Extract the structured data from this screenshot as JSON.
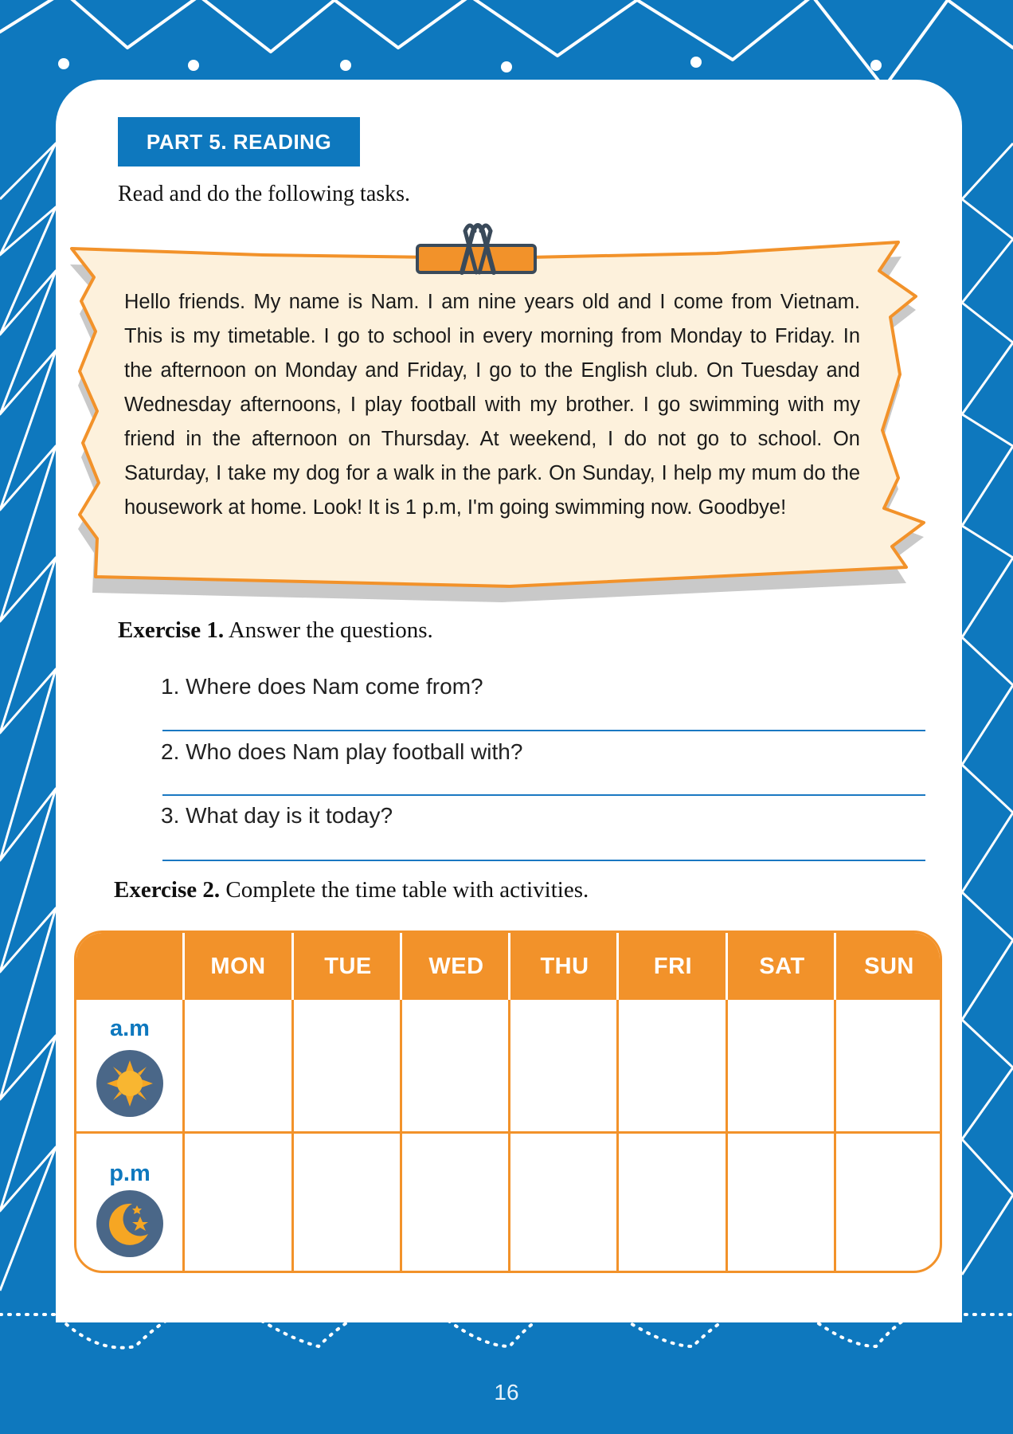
{
  "section": {
    "title": "PART 5. READING"
  },
  "instruction": "Read and do the following tasks.",
  "passage": "Hello friends. My name is Nam. I am nine years old and I come from Vietnam. This is my timetable. I go to school in every morning from Monday to Friday. In the afternoon on Monday and Friday, I go to the English club. On Tuesday and Wednesday afternoons, I play football with my brother. I go swimming with my friend in the afternoon on Thursday. At weekend, I do not go to school. On Saturday, I take my dog for a walk in the park. On Sunday, I help my mum do the housework at home. Look! It is 1 p.m, I'm going swimming now. Goodbye!",
  "exercise1": {
    "label": "Exercise 1.",
    "text": "Answer the questions.",
    "questions": [
      "1. Where does Nam come from?",
      "2. Who does Nam play football with?",
      "3. What day is it today?"
    ]
  },
  "exercise2": {
    "label": "Exercise 2.",
    "text": "Complete the time table with activities."
  },
  "timetable": {
    "days": [
      "MON",
      "TUE",
      "WED",
      "THU",
      "FRI",
      "SAT",
      "SUN"
    ],
    "periods": [
      {
        "label": "a.m",
        "icon": "sun-icon"
      },
      {
        "label": "p.m",
        "icon": "moon-stars-icon"
      }
    ]
  },
  "page_number": "16",
  "colors": {
    "blue": "#0e78be",
    "orange": "#f2922a",
    "paper": "#fdf1dc"
  }
}
